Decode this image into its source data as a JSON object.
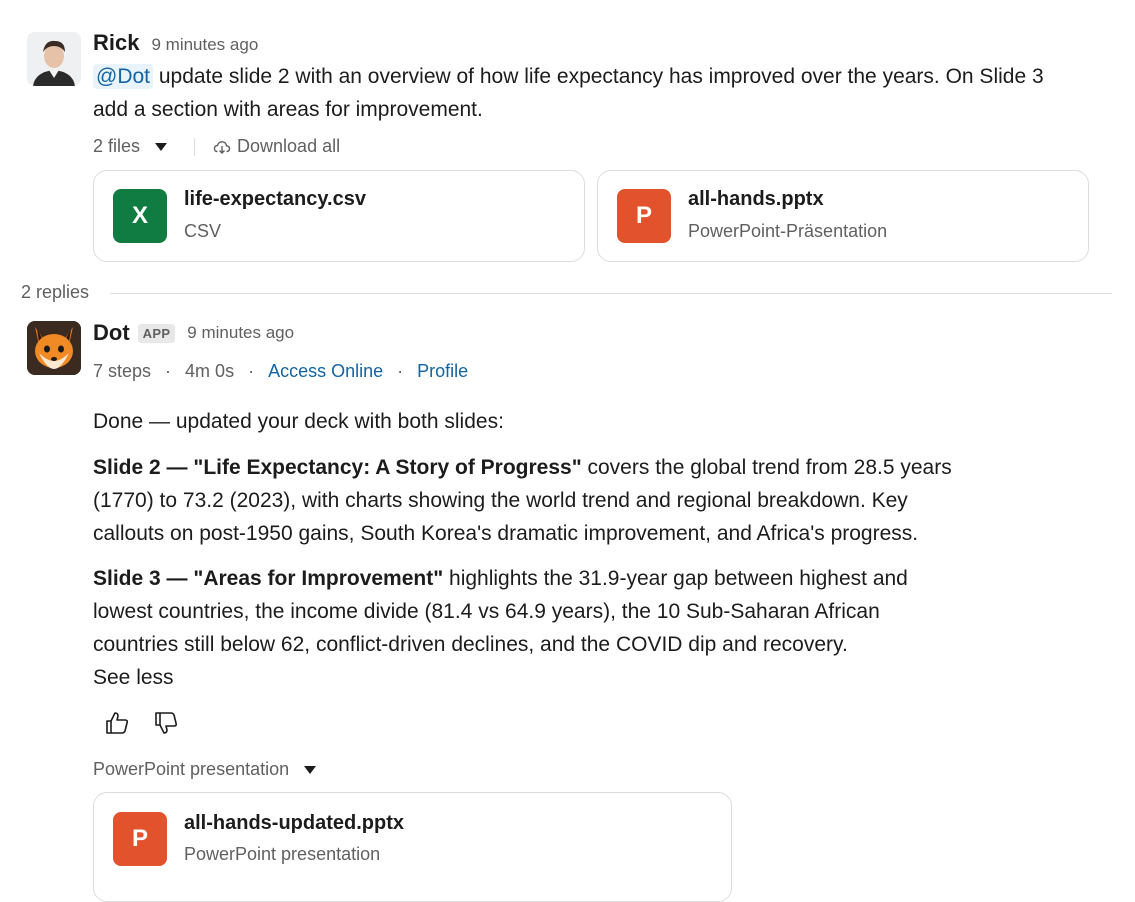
{
  "first_message": {
    "author": "Rick",
    "time": "9 minutes ago",
    "mention": "@Dot",
    "text_line1": " update slide 2 with an overview of how life expectancy has improved over the years. On Slide 3",
    "text_line2": "add a section with areas for improvement.",
    "files_count": "2 files",
    "download_all": "Download all",
    "files": [
      {
        "icon_letter": "X",
        "name": "life-expectancy.csv",
        "type": "CSV",
        "icon_color": "#107c41"
      },
      {
        "icon_letter": "P",
        "name": "all-hands.pptx",
        "type": "PowerPoint-Präsentation",
        "icon_color": "#e2522d"
      }
    ]
  },
  "thread": {
    "replies_label": "2 replies"
  },
  "reply": {
    "author": "Dot",
    "app_badge": "APP",
    "time": "9 minutes ago",
    "steps": "7 steps",
    "duration": "4m 0s",
    "access_online": "Access Online",
    "profile": "Profile",
    "intro": "Done — updated your deck with both slides:",
    "slide2_heading": "Slide 2 — \"Life Expectancy: A Story of Progress\"",
    "slide2_line1": " covers the global trend from 28.5 years",
    "slide2_line2": "(1770) to 73.2 (2023), with charts showing the world trend and regional breakdown. Key",
    "slide2_line3": "callouts on post-1950 gains, South Korea's dramatic improvement, and Africa's progress.",
    "slide3_heading": "Slide 3 — \"Areas for Improvement\"",
    "slide3_line1": " highlights the 31.9-year gap between highest and",
    "slide3_line2": "lowest countries, the income divide (81.4 vs 64.9 years), the 10 Sub-Saharan African",
    "slide3_line3": "countries still below 62, conflict-driven declines, and the COVID dip and recovery.",
    "see_less": "See less",
    "attachment_label": "PowerPoint presentation",
    "attachment": {
      "icon_letter": "P",
      "name": "all-hands-updated.pptx",
      "type": "PowerPoint presentation",
      "icon_color": "#e2522d"
    }
  },
  "colors": {
    "link": "#1264a3",
    "excel_green": "#107c41",
    "ppt_orange": "#e2522d"
  }
}
